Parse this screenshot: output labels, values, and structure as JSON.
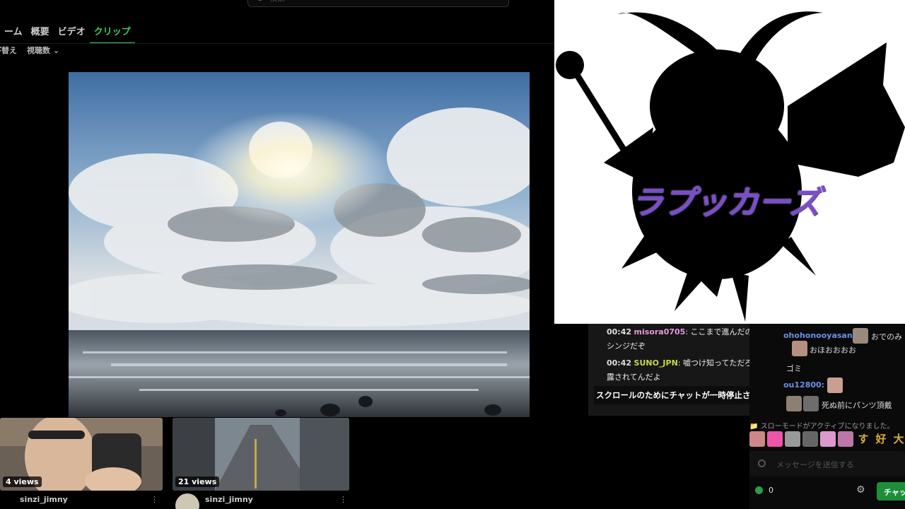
{
  "search": {
    "placeholder": "検索"
  },
  "tabs": [
    {
      "label": "ーム"
    },
    {
      "label": "概要"
    },
    {
      "label": "ビデオ"
    },
    {
      "label": "クリップ",
      "active": true
    }
  ],
  "sort": {
    "label": "並び替え",
    "value": "視聴数"
  },
  "clips": [
    {
      "views": "4 views",
      "uploader": "sinzi_jimny"
    },
    {
      "views": "21 views",
      "uploader": "sinzi_jimny"
    }
  ],
  "logo": {
    "title": "ラプッカーズ"
  },
  "chat_overlay": {
    "messages": [
      {
        "time": "00:42",
        "user": "misora0705",
        "text": "ここまで進んだのは",
        "text2": "シンジだぞ"
      },
      {
        "time": "00:42",
        "user": "SUNO_JPN",
        "text": "嘘つけ知ってただろ暴",
        "text2": "露されてんだよ"
      }
    ],
    "paused_notice": "スクロールのためにチャットが一時停止されました"
  },
  "right_chat": {
    "lines": [
      {
        "user": "ohohonooyasan:",
        "text": "おでのみ"
      },
      {
        "user": "",
        "text": "おほおおおお"
      },
      {
        "user": "",
        "text": "ゴミ"
      },
      {
        "user": "ou12800:",
        "text": ""
      },
      {
        "user": "",
        "text": "死ぬ前にパンツ頂戴"
      }
    ],
    "slow_mode": "スローモードがアクティブになりました。",
    "emote_text": [
      "す",
      "好",
      "大"
    ],
    "message_placeholder": "メッセージを送信する",
    "points": "0",
    "chat_button": "チャット"
  },
  "colors": {
    "accent": "#3ecf5a",
    "logo_text": "#7a4fc4"
  }
}
